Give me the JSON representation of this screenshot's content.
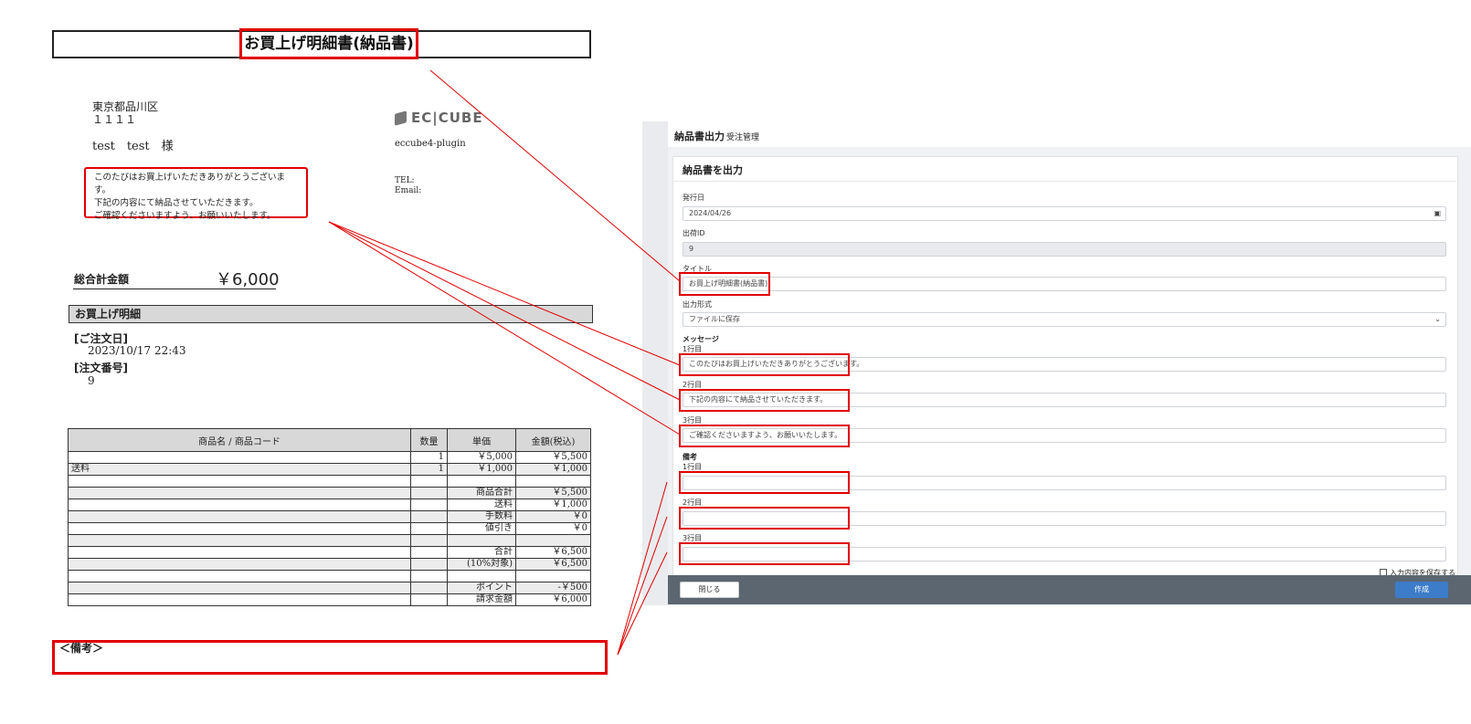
{
  "invoice": {
    "title": "お買上げ明細書(納品書)",
    "address_line1": "東京都品川区",
    "address_line2": "１１１１",
    "customer": "test　test　様",
    "logo_text": "EC|CUBE",
    "shop_name": "eccube4-plugin",
    "tel_label": "TEL:",
    "email_label": "Email:",
    "message": [
      "このたびはお買上げいただきありがとうございます。",
      "下記の内容にて納品させていただきます。",
      "ご確認くださいますよう、お願いいたします。"
    ],
    "total_label": "総合計金額",
    "total_value": "￥6,000",
    "detail_heading": "お買上げ明細",
    "order_date_label": "[ご注文日]",
    "order_date": "2023/10/17 22:43",
    "order_no_label": "[注文番号]",
    "order_no": "9",
    "table_headers": [
      "商品名 / 商品コード",
      "数量",
      "単価",
      "金額(税込)"
    ],
    "table_rows": [
      [
        "",
        "1",
        "￥5,000",
        "￥5,500"
      ],
      [
        "送料",
        "1",
        "￥1,000",
        "￥1,000"
      ],
      [
        "",
        "",
        "",
        ""
      ],
      [
        "",
        "",
        "商品合計",
        "￥5,500"
      ],
      [
        "",
        "",
        "送料",
        "￥1,000"
      ],
      [
        "",
        "",
        "手数料",
        "￥0"
      ],
      [
        "",
        "",
        "値引き",
        "￥0"
      ],
      [
        "",
        "",
        "",
        ""
      ],
      [
        "",
        "",
        "合計",
        "￥6,500"
      ],
      [
        "",
        "",
        "(10%対象)",
        "￥6,500"
      ],
      [
        "",
        "",
        "",
        ""
      ],
      [
        "",
        "",
        "ポイント",
        "-￥500"
      ],
      [
        "",
        "",
        "請求金額",
        "￥6,000"
      ]
    ],
    "remarks_label": "＜備考＞"
  },
  "panel": {
    "title": "納品書出力",
    "subtitle": "受注管理",
    "card_title": "納品書を出力",
    "issue_date_label": "発行日",
    "issue_date_value": "2024/04/26",
    "shipping_id_label": "出荷ID",
    "shipping_id_value": "9",
    "title_label": "タイトル",
    "title_value": "お買上げ明細書(納品書)",
    "format_label": "出力形式",
    "format_value": "ファイルに保存",
    "message_label": "メッセージ",
    "line1_label": "1行目",
    "line2_label": "2行目",
    "line3_label": "3行目",
    "message_values": [
      "このたびはお買上げいただきありがとうございます。",
      "下記の内容にて納品させていただきます。",
      "ご確認くださいますよう、お願いいたします。"
    ],
    "remarks_label": "備考",
    "remarks_values": [
      "",
      "",
      ""
    ],
    "save_input_label": "入力内容を保存する",
    "close_label": "閉じる",
    "create_label": "作成"
  },
  "colors": {
    "highlight": "#e00000",
    "footer": "#5b6670",
    "primary": "#3d7cc9"
  }
}
